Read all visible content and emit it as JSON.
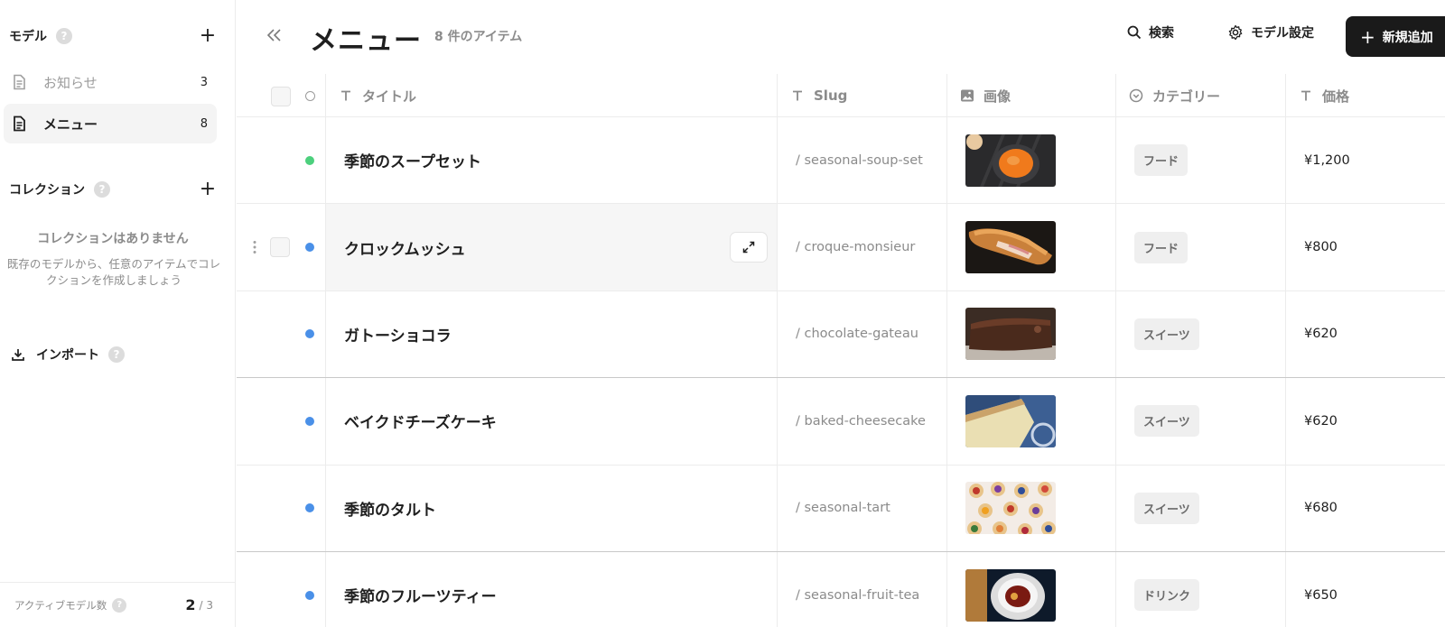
{
  "sidebar": {
    "models_title": "モデル",
    "models": [
      {
        "label": "お知らせ",
        "count": "3"
      },
      {
        "label": "メニュー",
        "count": "8"
      }
    ],
    "collections_title": "コレクション",
    "empty_title": "コレクションはありません",
    "empty_desc": "既存のモデルから、任意のアイテムでコレクションを作成しましょう",
    "import_label": "インポート",
    "footer_label": "アクティブモデル数",
    "footer_value": "2",
    "footer_total": "/ 3"
  },
  "header": {
    "title": "メニュー",
    "item_count": "8 件のアイテム",
    "search_label": "検索",
    "settings_label": "モデル設定",
    "add_label": "新規追加"
  },
  "columns": [
    "タイトル",
    "Slug",
    "画像",
    "カテゴリー",
    "価格"
  ],
  "rows": [
    {
      "title": "季節のスープセット",
      "slug": "/ seasonal-soup-set",
      "category": "フード",
      "price": "¥1,200",
      "status_color": "#4cd07d",
      "image": "soup"
    },
    {
      "title": "クロックムッシュ",
      "slug": "/ croque-monsieur",
      "category": "フード",
      "price": "¥800",
      "status_color": "#4a90e8",
      "image": "croque"
    },
    {
      "title": "ガトーショコラ",
      "slug": "/ chocolate-gateau",
      "category": "スイーツ",
      "price": "¥620",
      "status_color": "#4a90e8",
      "image": "gateau"
    },
    {
      "title": "ベイクドチーズケーキ",
      "slug": "/ baked-cheesecake",
      "category": "スイーツ",
      "price": "¥620",
      "status_color": "#4a90e8",
      "image": "cheesecake"
    },
    {
      "title": "季節のタルト",
      "slug": "/ seasonal-tart",
      "category": "スイーツ",
      "price": "¥680",
      "status_color": "#4a90e8",
      "image": "tart"
    },
    {
      "title": "季節のフルーツティー",
      "slug": "/ seasonal-fruit-tea",
      "category": "ドリンク",
      "price": "¥650",
      "status_color": "#4a90e8",
      "image": "tea"
    }
  ]
}
